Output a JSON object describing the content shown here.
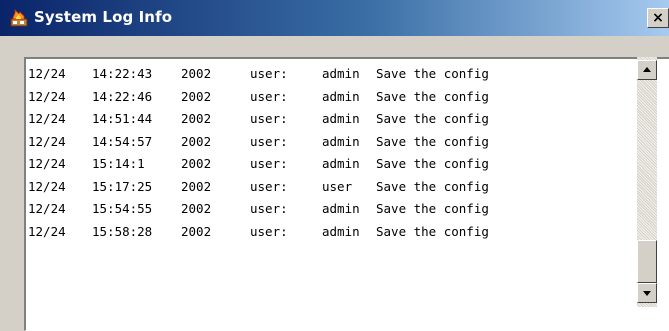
{
  "window": {
    "title": "System Log Info",
    "close_glyph": "×",
    "title_icon": "app-flame-icon"
  },
  "log": {
    "entries": [
      {
        "date": "12/24",
        "time": "14:22:43",
        "year": "2002",
        "label": "user:",
        "user": "admin",
        "action": "Save the config"
      },
      {
        "date": "12/24",
        "time": "14:22:46",
        "year": "2002",
        "label": "user:",
        "user": "admin",
        "action": "Save the config"
      },
      {
        "date": "12/24",
        "time": "14:51:44",
        "year": "2002",
        "label": "user:",
        "user": "admin",
        "action": "Save the config"
      },
      {
        "date": "12/24",
        "time": "14:54:57",
        "year": "2002",
        "label": "user:",
        "user": "admin",
        "action": "Save the config"
      },
      {
        "date": "12/24",
        "time": "15:14:1",
        "year": "2002",
        "label": "user:",
        "user": "admin",
        "action": "Save the config"
      },
      {
        "date": "12/24",
        "time": "15:17:25",
        "year": "2002",
        "label": "user:",
        "user": "user",
        "action": "Save the config"
      },
      {
        "date": "12/24",
        "time": "15:54:55",
        "year": "2002",
        "label": "user:",
        "user": "admin",
        "action": "Save the config"
      },
      {
        "date": "12/24",
        "time": "15:58:28",
        "year": "2002",
        "label": "user:",
        "user": "admin",
        "action": "Save the config"
      }
    ]
  },
  "scrollbar": {
    "up_icon": "arrow-up-icon",
    "down_icon": "arrow-down-icon"
  }
}
